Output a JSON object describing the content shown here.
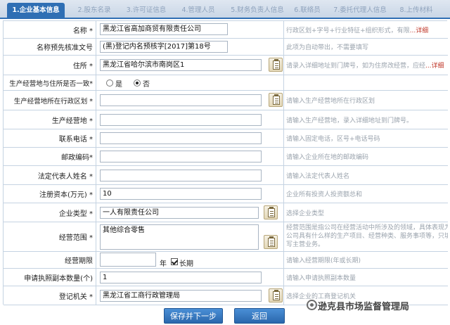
{
  "tabs": [
    {
      "label": "1.企业基本信息"
    },
    {
      "label": "2.股东名录"
    },
    {
      "label": "3.许可证信息"
    },
    {
      "label": "4.管理人员"
    },
    {
      "label": "5.财务负责人信息"
    },
    {
      "label": "6.联络员"
    },
    {
      "label": "7.委托代理人信息"
    },
    {
      "label": "8.上传材料"
    }
  ],
  "form": {
    "name": {
      "label": "名称 *",
      "value": "黑龙江省高加商贸有限责任公司",
      "hint": "行政区划+字号+行业特征+组织形式，有限",
      "more": "...详细"
    },
    "approval_no": {
      "label": "名称预先核准文号",
      "value": "(黑)登记内名预核字[2017]第18号",
      "hint": "此项为自动带出，不需要填写"
    },
    "address": {
      "label": "住所 *",
      "value": "黑龙江省哈尔滨市南岗区1",
      "hint": "请录入详细地址到门牌号，如为住房改经营，应经",
      "more": "...详细"
    },
    "same_address": {
      "label": "生产经营地与住所是否一致*",
      "opt_yes": "是",
      "opt_no": "否",
      "selected": "否"
    },
    "biz_region": {
      "label": "生产经营地所在行政区划 *",
      "value": "",
      "hint": "请输入生产经营地所在行政区划"
    },
    "biz_address": {
      "label": "生产经营地 *",
      "value": "",
      "hint": "请输入生产经营地，录入详细地址到门牌号。"
    },
    "phone": {
      "label": "联系电话 *",
      "value": "",
      "hint": "请输入固定电话，区号+电话号码"
    },
    "postcode": {
      "label": "邮政编码*",
      "value": "",
      "hint": "请输入企业所在地的邮政编码"
    },
    "legal_rep": {
      "label": "法定代表人姓名 *",
      "value": "",
      "hint": "请输入法定代表人姓名"
    },
    "capital": {
      "label": "注册资本(万元) *",
      "value": "10",
      "hint": "企业所有投资人投资额总和"
    },
    "company_type": {
      "label": "企业类型 *",
      "value": "一人有限责任公司",
      "hint": "选择企业类型"
    },
    "scope": {
      "label": "经营范围 *",
      "value": "其他综合零售",
      "hint1": "经营范围是指公司在经营活动中所涉及的领域，具体表现为",
      "hint2": "公司具有什么样的生产项目、经营种类、服务事项等，只填",
      "hint3": "写主营业务。"
    },
    "term": {
      "label": "经营期限",
      "value": "",
      "unit": "年",
      "long_term": "长期",
      "hint": "请输入经营期限(年或长期)"
    },
    "copies": {
      "label": "申请执照副本数量(个)",
      "value": "1",
      "hint": "请输入申请执照副本数量"
    },
    "authority": {
      "label": "登记机关 *",
      "value": "黑龙江省工商行政管理局",
      "hint": "选择企业的工商登记机关"
    }
  },
  "buttons": {
    "save_next": "保存并下一步",
    "back": "返回"
  },
  "watermark": {
    "text": "逊克县市场监督管理局"
  }
}
